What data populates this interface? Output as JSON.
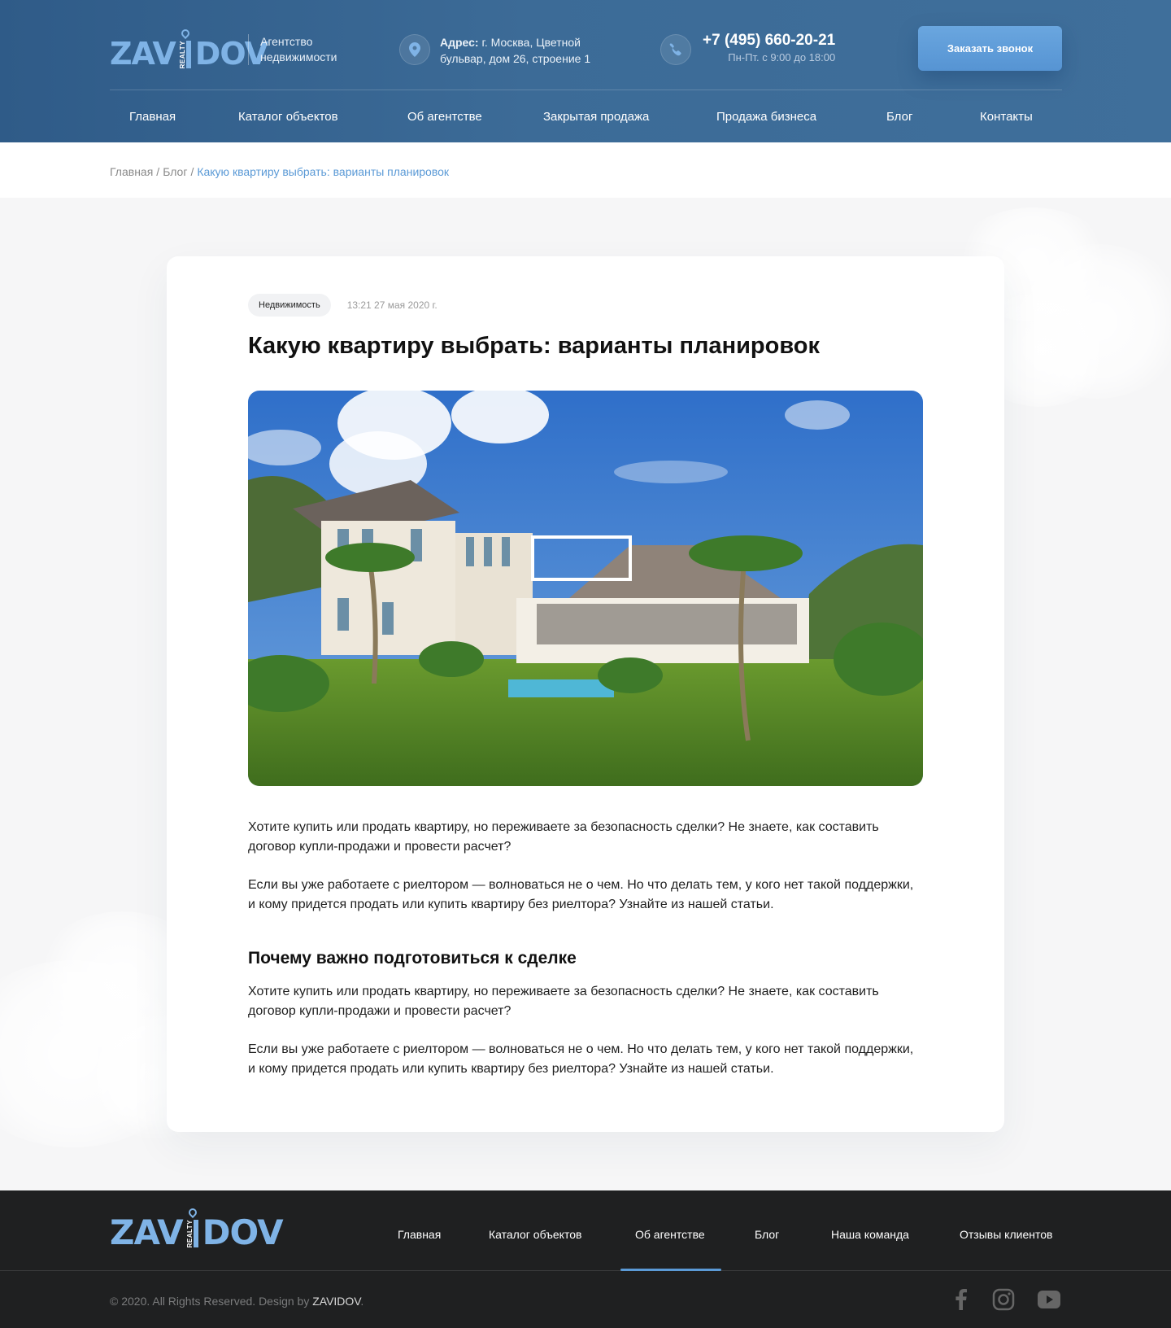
{
  "header": {
    "logo": {
      "left": "ZAV",
      "realty": "REALTY",
      "right": "DOV"
    },
    "tagline": "Агентство недвижимости",
    "address": {
      "label": "Адрес:",
      "text": " г. Москва, Цветной бульвар, дом 26, строение 1"
    },
    "phone": {
      "number": "+7 (495) 660-20-21",
      "hours": "Пн-Пт. с  9:00 до 18:00"
    },
    "call_button": "Заказать звонок",
    "nav": [
      "Главная",
      "Каталог объектов",
      "Об агентстве",
      "Закрытая продажа",
      "Продажа бизнеса",
      "Блог",
      "Контакты"
    ]
  },
  "breadcrumb": {
    "home": "Главная",
    "sep": "/",
    "blog": "Блог",
    "current": "Какую квартиру выбрать: варианты планировок"
  },
  "article": {
    "tag": "Недвижимость",
    "date": "13:21 27 мая 2020 г.",
    "title": "Какую квартиру выбрать: варианты планировок",
    "p1": "Хотите купить или продать квартиру, но переживаете за безопасность сделки? Не знаете, как составить договор купли-продажи и провести расчет?",
    "p2": "Если вы уже работаете с риелтором — волноваться не о чем. Но что делать тем, у кого нет такой поддержки, и кому придется продать или купить квартиру без риелтора? Узнайте из нашей статьи.",
    "h2": "Почему важно подготовиться к сделке",
    "p3": "Хотите купить или продать квартиру, но переживаете за безопасность сделки? Не знаете, как составить договор купли-продажи и провести расчет?",
    "p4": "Если вы уже работаете с риелтором — волноваться не о чем. Но что делать тем, у кого нет такой поддержки, и кому придется продать или купить квартиру без риелтора? Узнайте из нашей статьи."
  },
  "footer": {
    "logo": {
      "left": "ZAV",
      "realty": "REALTY",
      "right": "DOV"
    },
    "nav": [
      "Главная",
      "Каталог объектов",
      "Об агентстве",
      "Блог",
      "Наша команда",
      "Отзывы клиентов"
    ],
    "active_nav": "Об агентстве",
    "copyright_prefix": "© 2020. All Rights Reserved. Design by ",
    "copyright_brand": "ZAVIDOV",
    "copyright_suffix": ".",
    "social": [
      "facebook-icon",
      "instagram-icon",
      "youtube-icon"
    ]
  },
  "colors": {
    "accent": "#5b9ad6",
    "header_bg": "#3c6b97",
    "footer_bg": "#1f2021"
  }
}
